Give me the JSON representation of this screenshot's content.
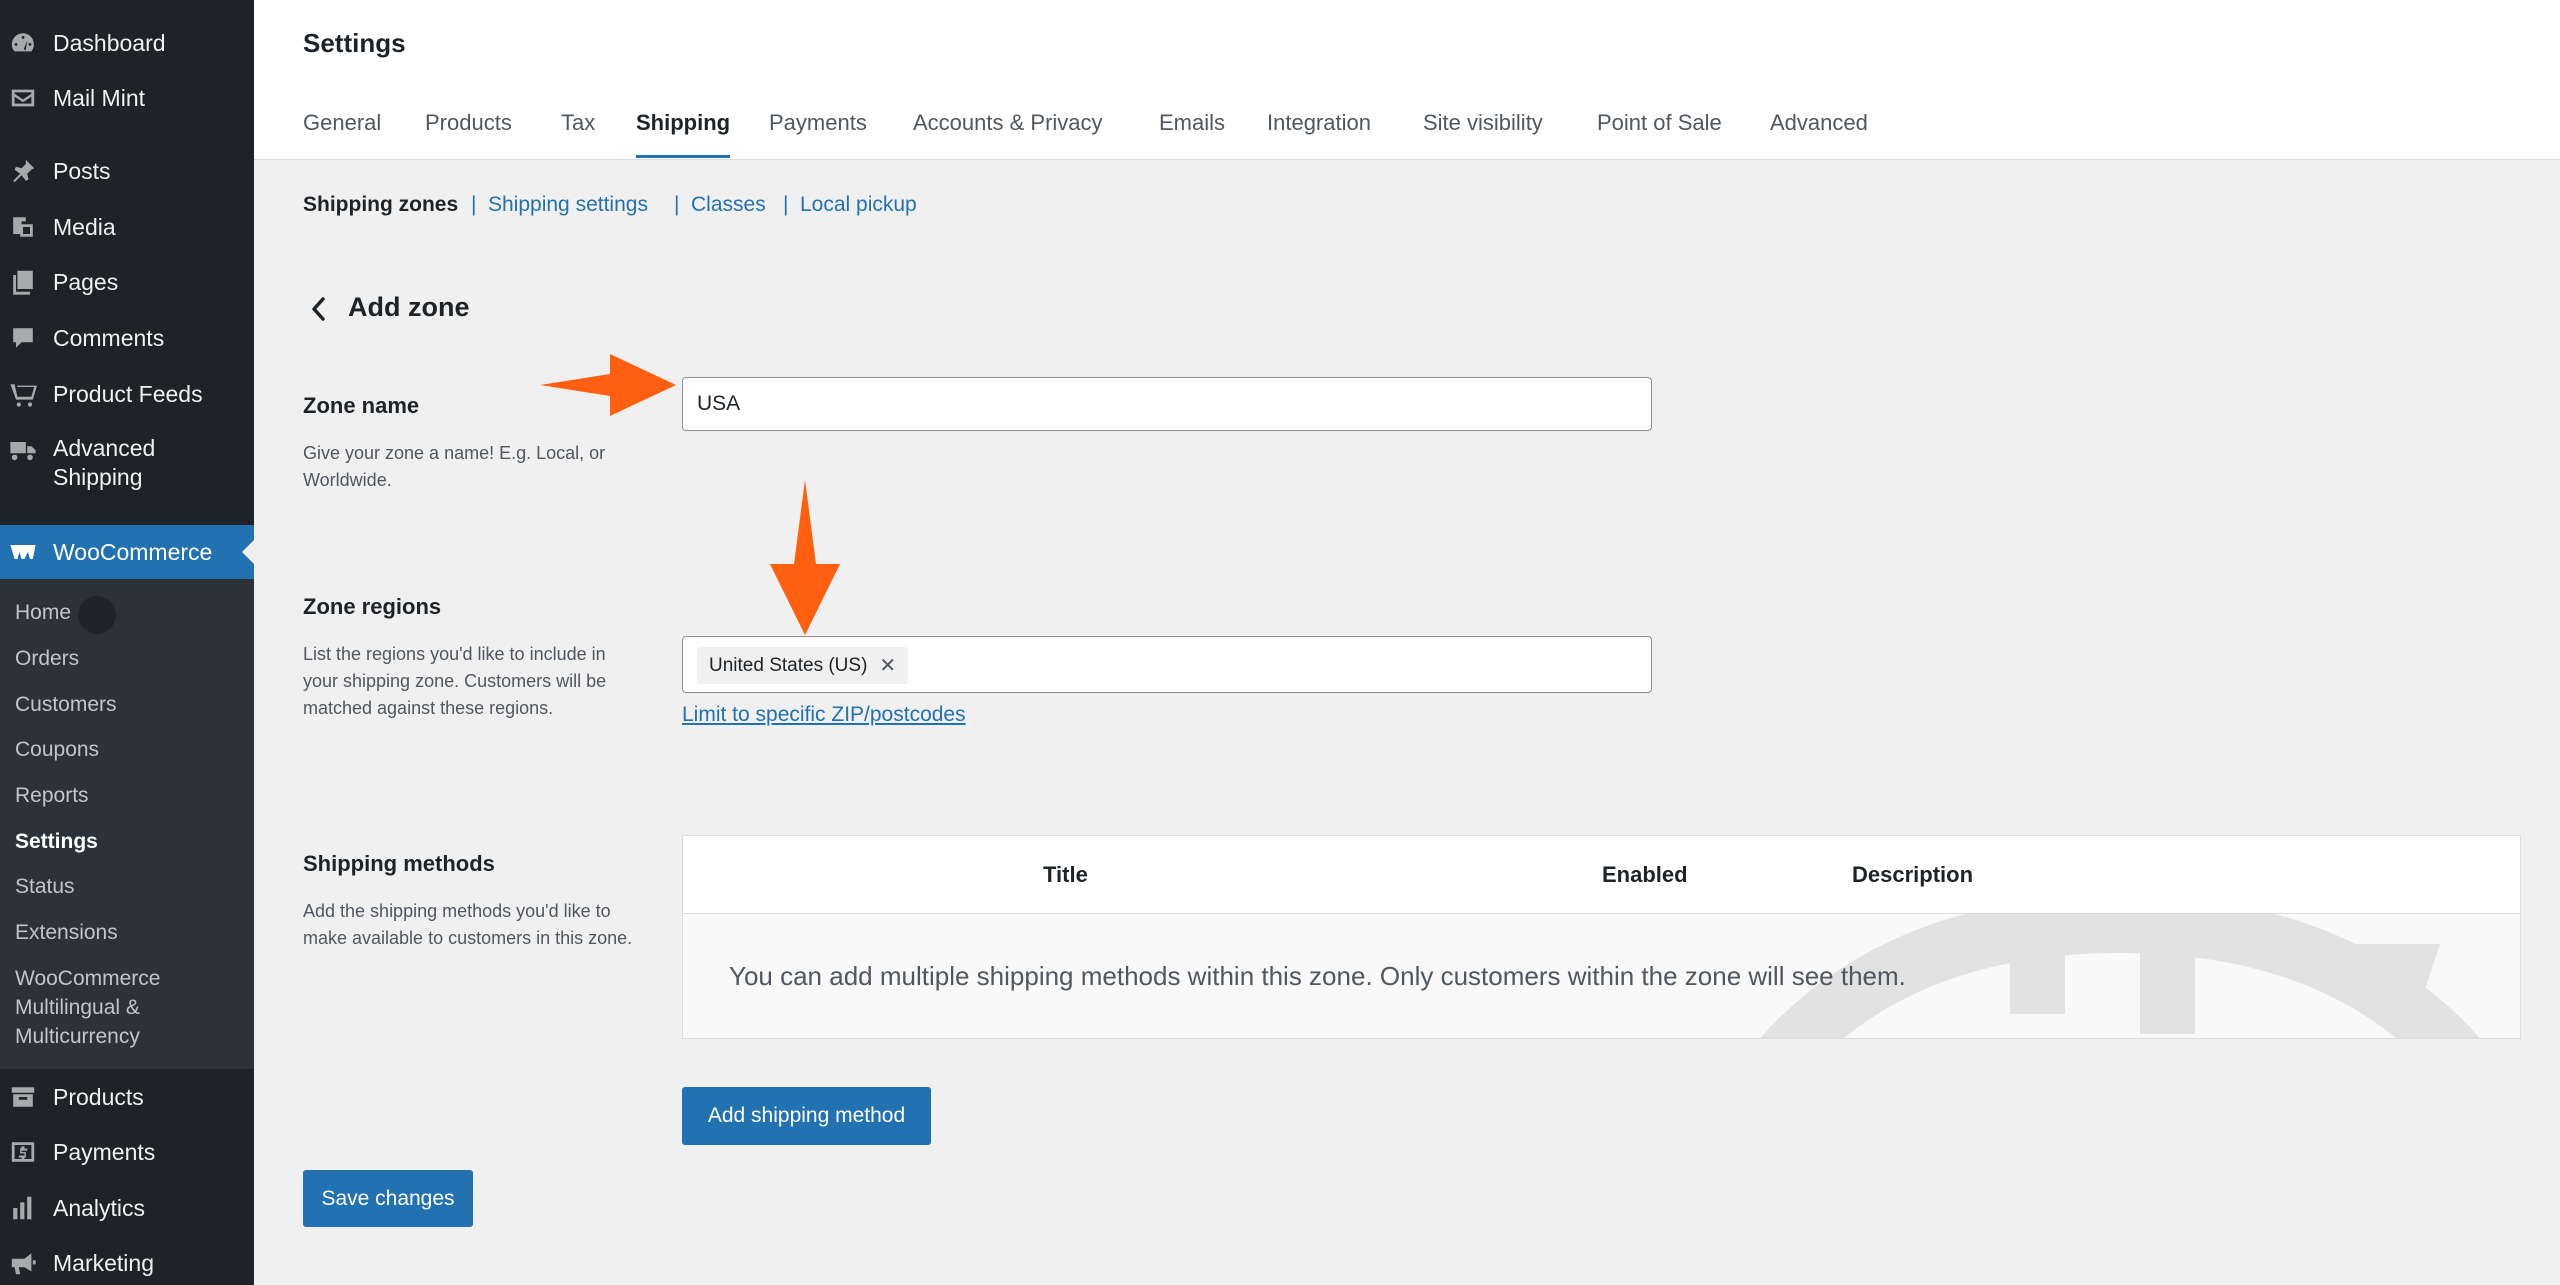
{
  "sidebar": {
    "top_items": [
      {
        "label": "Dashboard",
        "icon": "dashboard-icon"
      },
      {
        "label": "Mail Mint",
        "icon": "mail-icon"
      },
      {
        "label": "Posts",
        "icon": "pin-icon"
      },
      {
        "label": "Media",
        "icon": "media-icon"
      },
      {
        "label": "Pages",
        "icon": "pages-icon"
      },
      {
        "label": "Comments",
        "icon": "comments-icon"
      },
      {
        "label": "Product Feeds",
        "icon": "cart-icon"
      },
      {
        "label": "Advanced Shipping",
        "label_line1": "Advanced",
        "label_line2": "Shipping",
        "icon": "truck-icon"
      }
    ],
    "active_item": {
      "label": "WooCommerce",
      "icon": "woocommerce-icon"
    },
    "submenu": {
      "home": "Home",
      "orders": "Orders",
      "customers": "Customers",
      "coupons": "Coupons",
      "reports": "Reports",
      "settings": "Settings",
      "status": "Status",
      "extensions": "Extensions",
      "multilingual_line1": "WooCommerce",
      "multilingual_line2": "Multilingual &",
      "multilingual_line3": "Multicurrency"
    },
    "bottom_items": [
      {
        "label": "Products",
        "icon": "archive-icon"
      },
      {
        "label": "Payments",
        "icon": "dollar-icon"
      },
      {
        "label": "Analytics",
        "icon": "bar-chart-icon"
      },
      {
        "label": "Marketing",
        "icon": "megaphone-icon"
      }
    ]
  },
  "header": {
    "title": "Settings",
    "tabs": [
      "General",
      "Products",
      "Tax",
      "Shipping",
      "Payments",
      "Accounts & Privacy",
      "Emails",
      "Integration",
      "Site visibility",
      "Point of Sale",
      "Advanced"
    ],
    "active_tab": "Shipping"
  },
  "subnav": {
    "current": "Shipping zones",
    "separator": "|",
    "links": [
      "Shipping settings",
      "Classes",
      "Local pickup"
    ]
  },
  "zone": {
    "title": "Add zone",
    "name_label": "Zone name",
    "name_desc": "Give your zone a name! E.g. Local, or Worldwide.",
    "name_value": "USA",
    "regions_label": "Zone regions",
    "regions_desc": "List the regions you'd like to include in your shipping zone. Customers will be matched against these regions.",
    "region_chip": "United States (US)",
    "chip_remove": "✕",
    "zip_link": "Limit to specific ZIP/postcodes",
    "methods_label": "Shipping methods",
    "methods_desc": "Add the shipping methods you'd like to make available to customers in this zone.",
    "table_headers": {
      "title": "Title",
      "enabled": "Enabled",
      "description": "Description"
    },
    "blank_state": "You can add multiple shipping methods within this zone. Only customers within the zone will see them.",
    "add_method_button": "Add shipping method"
  },
  "save_button": "Save changes",
  "colors": {
    "accent": "#2271b1",
    "annotation_arrow": "#ff5f0f",
    "sidebar": "#1d2327"
  }
}
